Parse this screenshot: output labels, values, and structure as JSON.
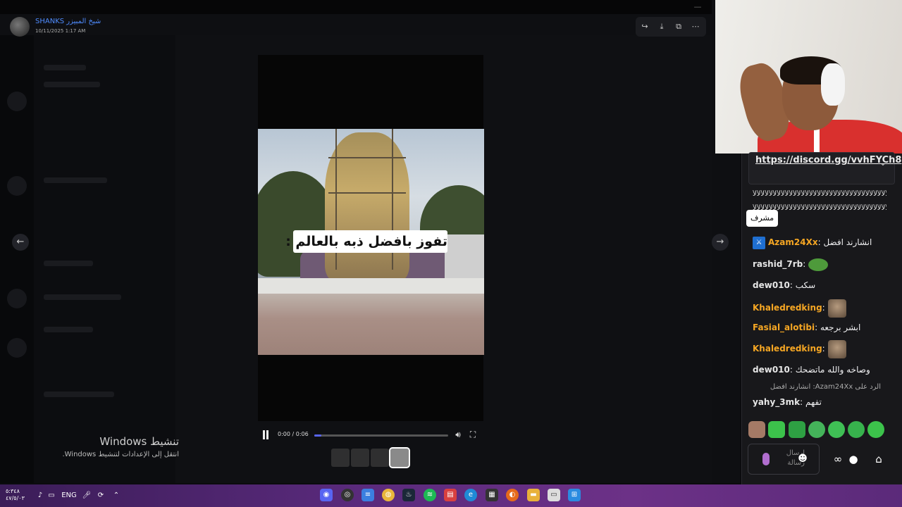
{
  "media_viewer": {
    "author": "SHANKS شيخ المبيزر",
    "date": "10/11/2025 1:17 AM",
    "caption": "تفوز بافضل ذبه بالعالم :",
    "time_label": "0:00 / 0:06",
    "progress_fraction": 0.0
  },
  "windows_activation": {
    "title": "تنشيط Windows",
    "subtitle": "انتقل إلى الإعدادات لتنشيط Windows."
  },
  "chat": {
    "pinned_link": "https://discord.gg/vvhFYCh8",
    "spam_line_1": "ﻷﻷﻷﻷﻷﻷﻷﻷﻷﻷﻷﻷﻷﻷﻷﻷﻷﻷﻷﻷﻷﻷﻷﻷﻷﻷﻷﻷﻷﻷﻷﻷﻷﻷﻷﻷﻷﻷﻷ",
    "spam_line_2": "ﻷﻷﻷﻷﻷﻷﻷﻷﻷﻷﻷﻷﻷﻷﻷﻷﻷﻷﻷﻷﻷﻷﻷﻷﻷﻷﻷﻷﻷﻷﻷﻷﻷﻷﻷﻷﻷﻷﻷ",
    "tooltip": "مشرف",
    "messages": [
      {
        "user": "Azam24Xx",
        "text": "انشارند افضل",
        "color": "#f5a623"
      },
      {
        "user": "rashid_7rb",
        "text": "",
        "color": "#e6e6e6"
      },
      {
        "user": "dew010",
        "text": "سكب",
        "color": "#e6e6e6"
      },
      {
        "user": "Khaledredking",
        "text": "",
        "color": "#f5a623"
      },
      {
        "user": "Fasial_alotibi",
        "text": "ابشر برجعه",
        "color": "#f5a623"
      },
      {
        "user": "Khaledredking",
        "text": "",
        "color": "#f5a623"
      },
      {
        "user": "dew010",
        "text": "وصاخه والله ماتضحك",
        "color": "#e6e6e6"
      },
      {
        "user": "yahy_3mk",
        "text": "تفهم",
        "color": "#e6e6e6"
      }
    ],
    "reply_to": "الرد على Azam24Xx: انشارند افضل",
    "input_placeholder": "إرسال رسالة"
  },
  "taskbar": {
    "time": "٥:٣٤٨",
    "date": "٤٧/٥/٠٣",
    "lang": "ENG"
  },
  "colors": {
    "accent": "#5865f2",
    "link_blue": "#4f8cff",
    "mod_badge": "#1f6fd1",
    "highlight_user": "#f5a623"
  }
}
